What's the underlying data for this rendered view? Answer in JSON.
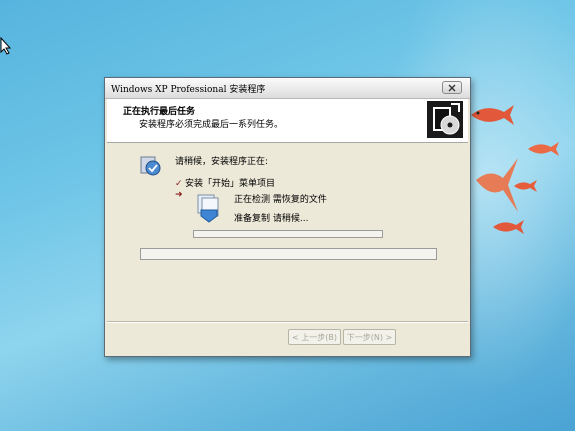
{
  "window": {
    "title": "Windows XP Professional 安装程序",
    "close_icon": "close-icon"
  },
  "header": {
    "title": "正在执行最后任务",
    "subtitle": "安装程序必须完成最后一系列任务。",
    "icon": "setup-cd-icon"
  },
  "content": {
    "please_wait": "请稍候，安装程序正在:",
    "steps": [
      {
        "label": "安装「开始」菜单项目",
        "mark": "✓",
        "state": "done"
      },
      {
        "label": "",
        "mark": "➜",
        "state": "current"
      }
    ],
    "current_action": "正在检测 需恢复的文件",
    "current_detail": "准备复制 请稍候...",
    "sub_progress": 0,
    "main_progress": 0
  },
  "buttons": {
    "back": "< 上一步(B)",
    "next": "下一步(N) >"
  },
  "colors": {
    "dialog_bg": "#ece9d8",
    "desktop": "#6cc4e6"
  }
}
